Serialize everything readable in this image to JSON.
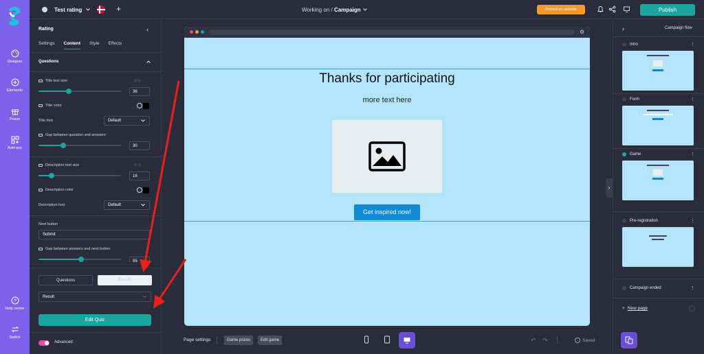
{
  "nav": {
    "designer": "Designer",
    "elements": "Elements",
    "prizes": "Prizes",
    "addons": "Add-ons",
    "help": "Help center",
    "switch": "Switch"
  },
  "topbar": {
    "project_name": "Test rating",
    "working_on_prefix": "Working on  /",
    "working_on_page": "Campaign",
    "embed_label": "Embed on website",
    "publish_label": "Publish"
  },
  "panel": {
    "title": "Rating",
    "tabs": [
      "Settings",
      "Content",
      "Style",
      "Effects"
    ],
    "active_tab": "Content",
    "section": "Questions",
    "title_text_size_label": "Title text size",
    "title_text_size": "36",
    "title_color_label": "Title color",
    "title_font_label": "Title font",
    "title_font": "Default",
    "gap_qa_label": "Gap between question and answers",
    "gap_qa": "30",
    "desc_text_size_label": "Description text size",
    "desc_text_size": "16",
    "desc_color_label": "Description color",
    "desc_font_label": "Description font",
    "desc_font": "Default",
    "next_button_label": "Next button",
    "next_button_value": "Submit",
    "gap_next_label": "Gap between answers and next button",
    "gap_next_partial": "55",
    "seg_questions": "Questions",
    "seg_results": "Results",
    "result_select": "Result",
    "edit_quiz": "Edit Quiz",
    "advanced": "Advanced",
    "sliders": {
      "title_size": 0.37,
      "gap_qa": 0.3,
      "desc_size": 0.16,
      "gap_next": 0.52
    }
  },
  "canvas": {
    "title": "Thanks for participating",
    "subtitle": "more text here",
    "cta": "Get inspired now!"
  },
  "bottombar": {
    "page_settings": "Page settings",
    "game_prizes": "Game prizes",
    "edit_game": "Edit game",
    "saved": "Saved"
  },
  "flow": {
    "header": "Campaign flow",
    "pages": [
      {
        "name": "Intro",
        "active": false
      },
      {
        "name": "Form",
        "active": false
      },
      {
        "name": "Game",
        "active": true
      },
      {
        "name": "Pre-registration",
        "active": false
      },
      {
        "name": "Campaign ended",
        "active": false
      }
    ],
    "new_page": "New page"
  },
  "colors": {
    "rail": "#7b62ea",
    "accent": "#19a69e",
    "embed": "#f39c2b",
    "canvas_bg": "#b4e4fa",
    "cta": "#1189d4",
    "arrow": "#e8201c"
  }
}
